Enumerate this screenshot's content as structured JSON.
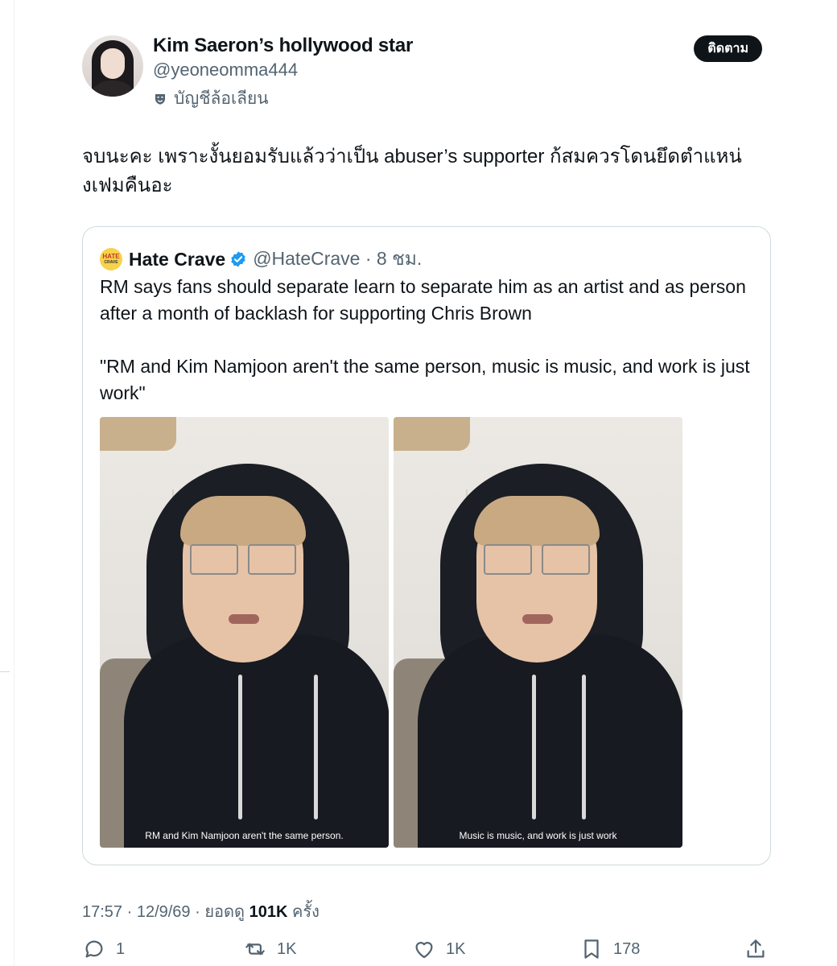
{
  "author": {
    "display_name": "Kim Saeron’s hollywood star",
    "handle": "@yeoneomma444",
    "parody_label": "บัญชีล้อเลียน"
  },
  "follow_button_label": "ติดตาม",
  "tweet_text": "จบนะคะ เพราะงั้นยอมรับแล้วว่าเป็น abuser’s supporter ก้สมควรโดนยึดตำแหน่งเฟมคืนอะ",
  "quoted": {
    "avatar_text_top": "HATE",
    "avatar_text_bottom": "CRAVE",
    "name": "Hate Crave",
    "handle_time": "@HateCrave · 8 ชม.",
    "text": "RM says fans should separate learn to separate him as an artist and as person after a month of backlash for supporting Chris Brown\n\n\"RM and Kim Namjoon aren't the same person, music is music, and work is just work\"",
    "media": [
      {
        "caption": "RM and Kim Namjoon aren't the same person."
      },
      {
        "caption": "Music is music, and work is just work"
      }
    ]
  },
  "meta": {
    "timestamp": "17:57 · 12/9/69 · ยอดดู",
    "views": "101K",
    "views_suffix": "ครั้ง"
  },
  "actions": {
    "reply_count": "1",
    "retweet_count": "1K",
    "like_count": "1K",
    "bookmark_count": "178"
  },
  "colors": {
    "text": "#0f1419",
    "secondary": "#536471",
    "border": "#cfd9de",
    "verified": "#1d9bf0"
  }
}
